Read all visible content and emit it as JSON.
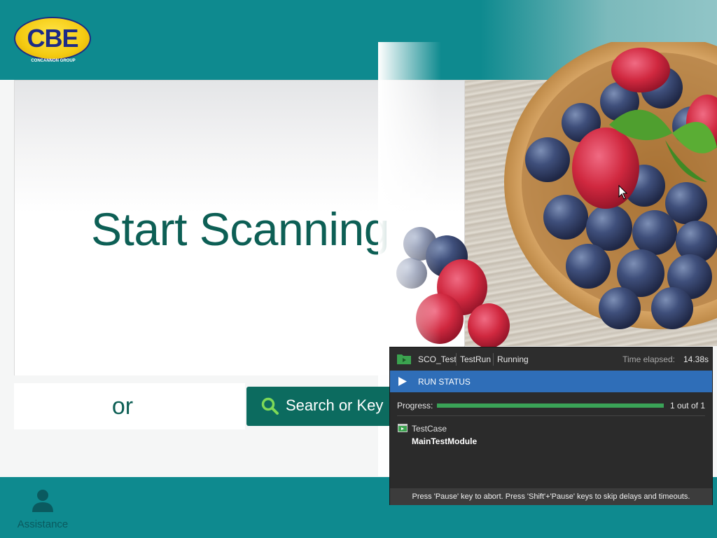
{
  "header": {
    "logo_text": "CBE",
    "logo_subtext": "CONCANNON GROUP"
  },
  "main": {
    "title": "Start Scanning",
    "or_text": "or",
    "search_button_label": "Search or Key"
  },
  "footer": {
    "assistance_label": "Assistance"
  },
  "run_status": {
    "project": "SCO_Test",
    "run": "TestRun",
    "state": "Running",
    "elapsed_label": "Time elapsed:",
    "elapsed_value": "14.38s",
    "status_title": "RUN STATUS",
    "progress_label": "Progress:",
    "progress_fraction": 1.0,
    "progress_count": "1 out of 1",
    "test_case": "TestCase",
    "module": "MainTestModule",
    "hint": "Press 'Pause' key to abort. Press 'Shift'+'Pause' keys to skip delays and timeouts."
  },
  "colors": {
    "teal": "#0e8a8f",
    "dark_green": "#0c6b5f",
    "title_green": "#0d5f55",
    "run_blue": "#2f6eb8",
    "progress_green": "#3aa357"
  },
  "icons": {
    "search": "search-icon",
    "assistance": "person-icon",
    "play": "play-icon",
    "folder": "folder-icon"
  }
}
